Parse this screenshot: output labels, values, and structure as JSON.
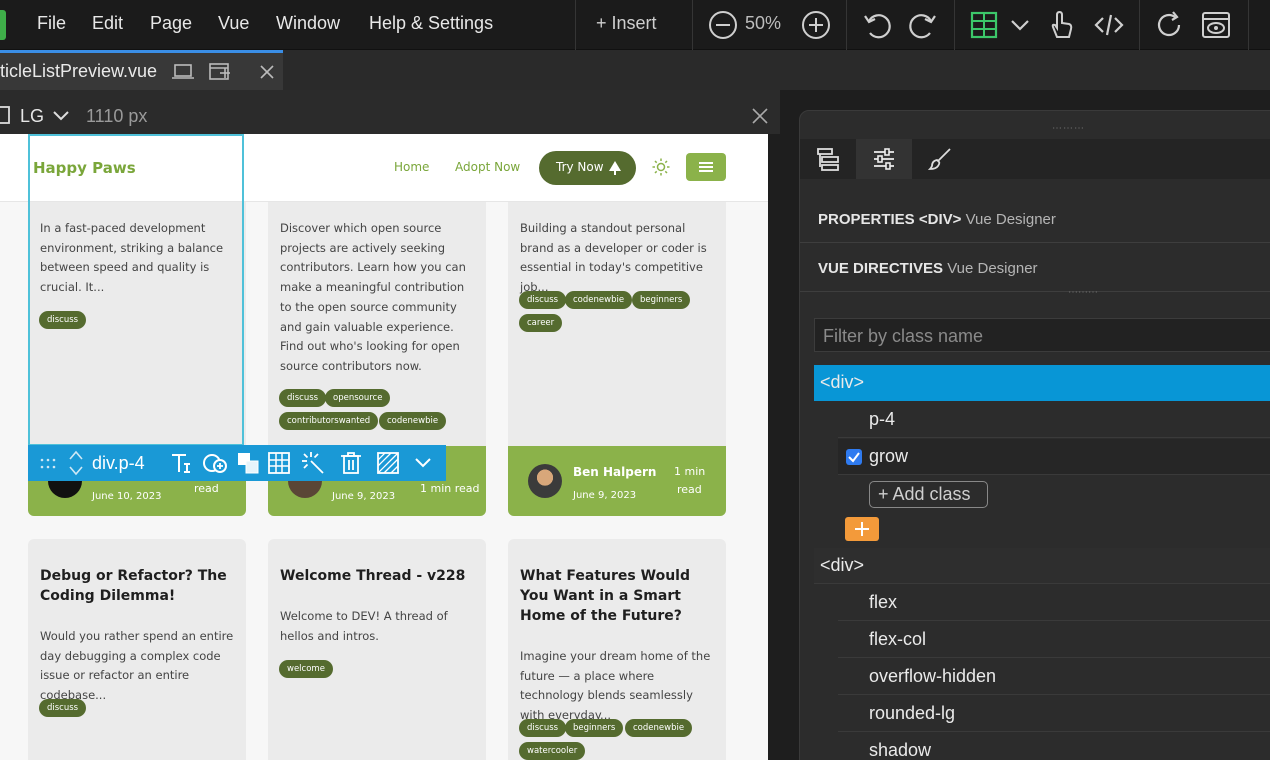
{
  "menubar": {
    "items": [
      "File",
      "Edit",
      "Page",
      "Vue",
      "Window",
      "Help & Settings"
    ],
    "insert_label": "+ Insert",
    "zoom": "50%"
  },
  "tab": {
    "filename": "ticleListPreview.vue"
  },
  "canvas_header": {
    "device": "LG",
    "width": "1110 px"
  },
  "site": {
    "brand": "Happy Paws",
    "nav": [
      "Home",
      "Adopt Now"
    ],
    "cta": "Try Now"
  },
  "cards": [
    {
      "body": "In a fast-paced development environment, striking a balance between speed and quality is crucial. It...",
      "tags": [
        "discuss"
      ],
      "date": "June 10, 2023",
      "read": "read"
    },
    {
      "body": "Discover which open source projects are actively seeking contributors. Learn how you can make a meaningful contribution to the open source community and gain valuable experience. Find out who's looking for open source contributors now.",
      "tags": [
        "discuss",
        "opensource",
        "contributorswanted",
        "codenewbie"
      ],
      "date": "June 9, 2023",
      "read": "1 min read"
    },
    {
      "body": "Building a standout personal brand as a developer or coder is essential in today's competitive job...",
      "tags": [
        "discuss",
        "codenewbie",
        "beginners",
        "career"
      ],
      "author": "Ben Halpern",
      "date": "June 9, 2023",
      "read_line1": "1 min",
      "read_line2": "read"
    },
    {
      "title": "Debug or Refactor? The Coding Dilemma!",
      "body": "Would you rather spend an entire day debugging a complex code issue or refactor an entire codebase...",
      "tags": [
        "discuss"
      ]
    },
    {
      "title": "Welcome Thread - v228",
      "body": "Welcome to DEV! A thread of hellos and intros.",
      "tags": [
        "welcome"
      ]
    },
    {
      "title": "What Features Would You Want in a Smart Home of the Future?",
      "body": "Imagine your dream home of the future — a place where technology blends seamlessly with everyday...",
      "tags": [
        "discuss",
        "beginners",
        "codenewbie",
        "watercooler"
      ]
    }
  ],
  "selection": {
    "label": "div.p-4"
  },
  "panel": {
    "properties_label": "PROPERTIES <DIV>",
    "properties_sub": "Vue Designer",
    "directives_label": "VUE DIRECTIVES",
    "directives_sub": "Vue Designer",
    "filter_placeholder": "Filter by class name",
    "node1": "<div>",
    "node1_classes": [
      "p-4",
      "grow"
    ],
    "add_class": "+ Add class",
    "node2": "<div>",
    "node2_classes": [
      "flex",
      "flex-col",
      "overflow-hidden",
      "rounded-lg",
      "shadow"
    ]
  },
  "colors": {
    "accent_blue": "#1a99d6",
    "site_green": "#8bb24a",
    "site_dark_green": "#556b2f",
    "orange": "#f39a3a"
  }
}
